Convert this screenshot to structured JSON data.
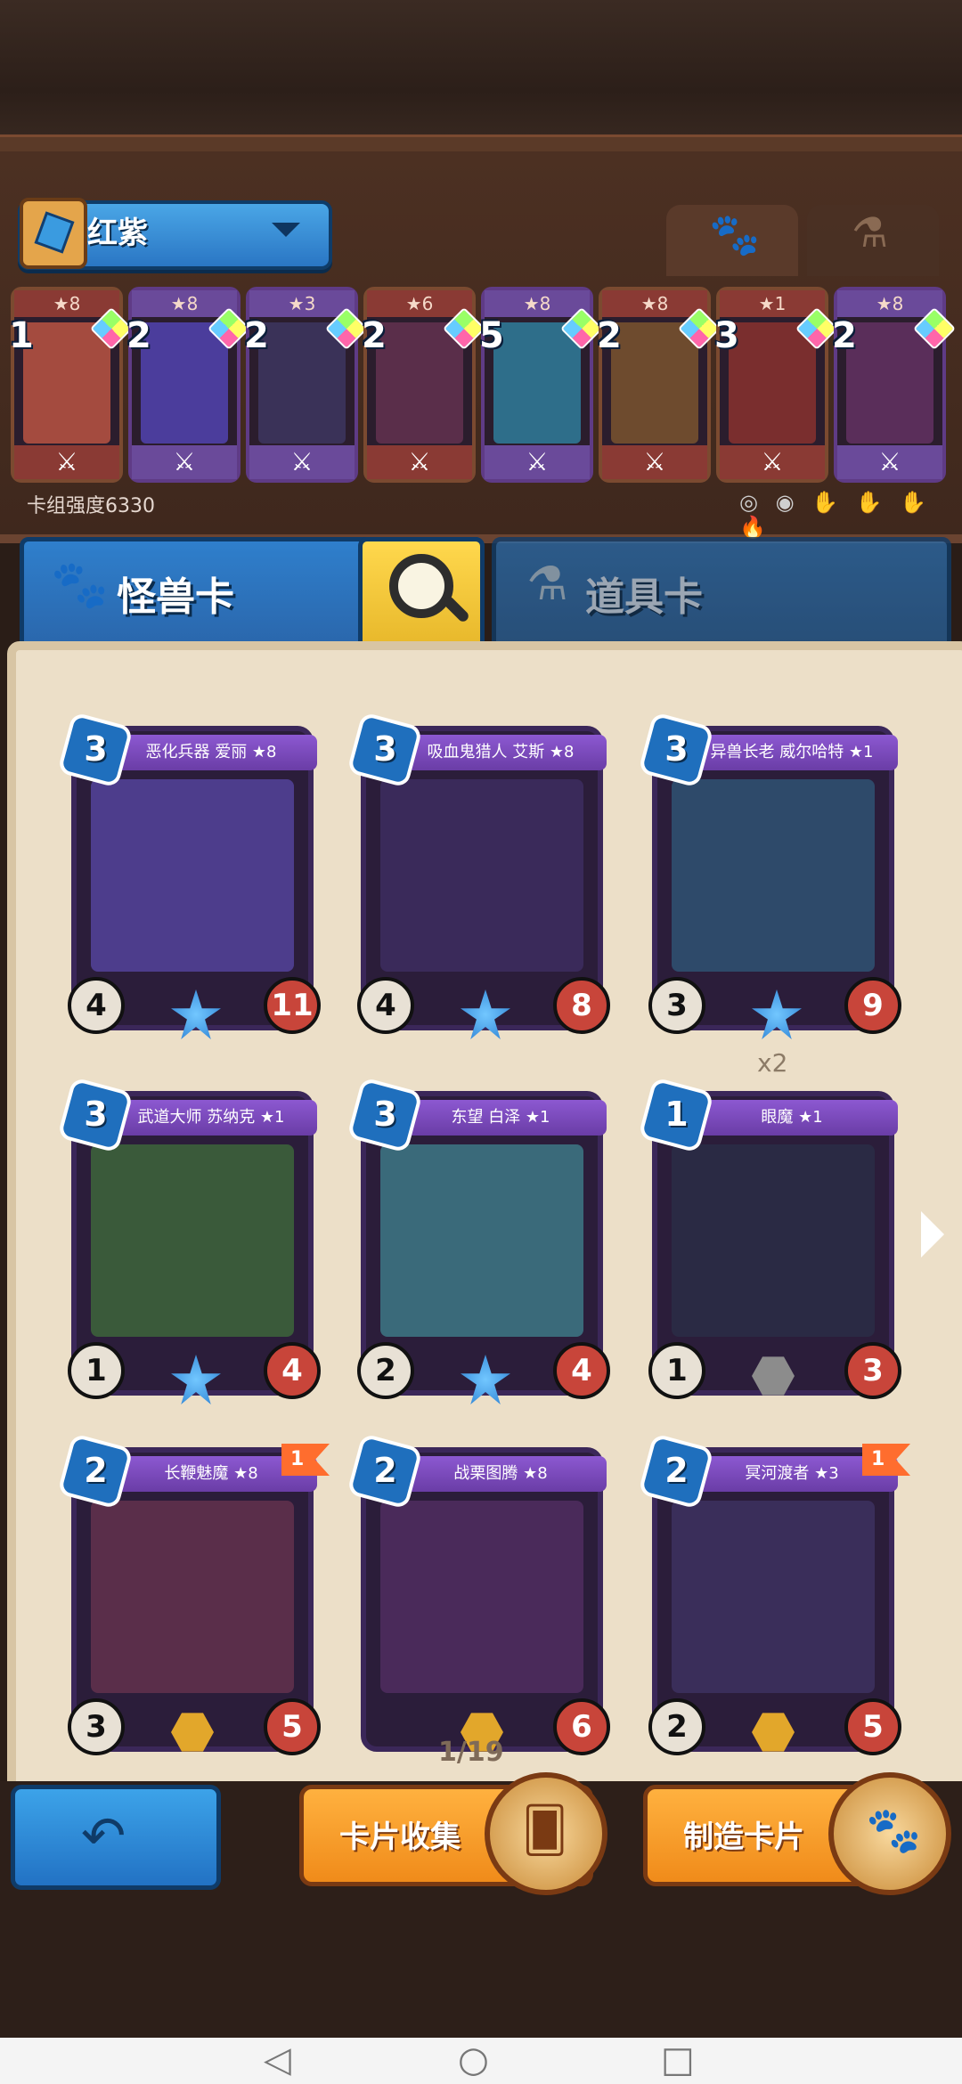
{
  "deck": {
    "name": "红紫",
    "power_label": "卡组强度6330",
    "mini_cards": [
      {
        "cost": "1",
        "stars": "★8",
        "style": "red",
        "art": "#a44b3f"
      },
      {
        "cost": "2",
        "stars": "★8",
        "style": "purple",
        "art": "#4b3d9c"
      },
      {
        "cost": "2",
        "stars": "★3",
        "style": "purple",
        "art": "#3a3258"
      },
      {
        "cost": "2",
        "stars": "★6",
        "style": "red",
        "art": "#5a2e4a"
      },
      {
        "cost": "5",
        "stars": "★8",
        "style": "purple",
        "art": "#2e6e8a"
      },
      {
        "cost": "2",
        "stars": "★8",
        "style": "red",
        "art": "#6e4b2e"
      },
      {
        "cost": "3",
        "stars": "★1",
        "style": "red",
        "art": "#7a2e2e"
      },
      {
        "cost": "2",
        "stars": "★8",
        "style": "purple",
        "art": "#5a2e5a"
      }
    ]
  },
  "tabs": {
    "monster": "怪兽卡",
    "items": "道具卡"
  },
  "cards": [
    {
      "title": "恶化兵器 爱丽 ★8",
      "cost": "3",
      "atk": "4",
      "hp": "11",
      "badge": "star",
      "art": "#4d3d8c"
    },
    {
      "title": "吸血鬼猎人 艾斯 ★8",
      "cost": "3",
      "atk": "4",
      "hp": "8",
      "badge": "star",
      "art": "#3a2a5a"
    },
    {
      "title": "异兽长老 威尔哈特 ★1",
      "cost": "3",
      "atk": "3",
      "hp": "9",
      "badge": "star",
      "art": "#2e4a6a"
    },
    {
      "title": "武道大师 苏纳克 ★1",
      "cost": "3",
      "atk": "1",
      "hp": "4",
      "badge": "star",
      "art": "#3a5a3a"
    },
    {
      "title": "东望 白泽 ★1",
      "cost": "3",
      "atk": "2",
      "hp": "4",
      "badge": "star",
      "art": "#3a6a7a"
    },
    {
      "title": "眼魔 ★1",
      "cost": "1",
      "atk": "1",
      "hp": "3",
      "badge": "gray",
      "copies": "x2",
      "art": "#2a2a44"
    },
    {
      "title": "长鞭魅魔 ★8",
      "cost": "2",
      "atk": "3",
      "hp": "5",
      "badge": "hex",
      "flag": "1",
      "art": "#5a2e4a"
    },
    {
      "title": "战栗图腾 ★8",
      "cost": "2",
      "atk": "",
      "hp": "6",
      "badge": "hex",
      "art": "#4a2a5a"
    },
    {
      "title": "冥河渡者 ★3",
      "cost": "2",
      "atk": "2",
      "hp": "5",
      "badge": "hex",
      "flag": "1",
      "art": "#3a2e5a"
    }
  ],
  "pager": "1/19",
  "buttons": {
    "collect": "卡片收集",
    "craft": "制造卡片"
  }
}
